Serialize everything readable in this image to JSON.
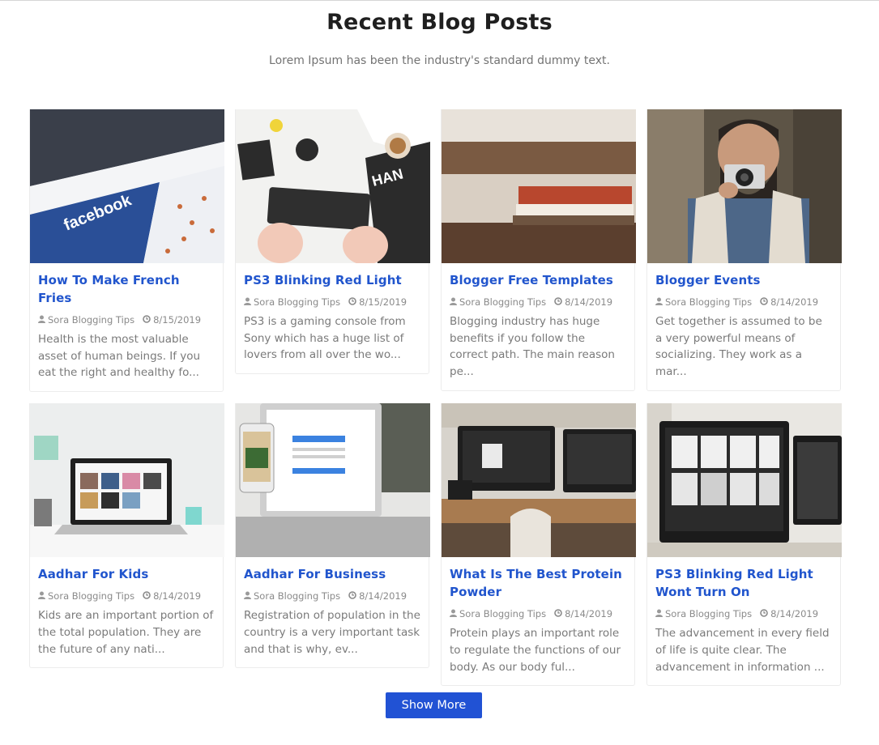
{
  "section": {
    "title": "Recent Blog Posts",
    "subtitle": "Lorem Ipsum has been the industry's standard dummy text."
  },
  "posts": [
    {
      "title": "How To Make French Fries",
      "author": "Sora Blogging Tips",
      "date": "8/15/2019",
      "excerpt": "Health is the most valuable asset of human beings. If you eat the right and healthy fo...",
      "image": "facebook-screen-photo"
    },
    {
      "title": "PS3 Blinking Red Light",
      "author": "Sora Blogging Tips",
      "date": "8/15/2019",
      "excerpt": "PS3 is a gaming console from Sony which has a huge list of lovers from all over the wo...",
      "image": "keyboard-desk-photo"
    },
    {
      "title": "Blogger Free Templates",
      "author": "Sora Blogging Tips",
      "date": "8/14/2019",
      "excerpt": "Blogging industry has huge benefits if you follow the correct path. The main reason pe...",
      "image": "books-on-stairs-photo"
    },
    {
      "title": "Blogger Events",
      "author": "Sora Blogging Tips",
      "date": "8/14/2019",
      "excerpt": "Get together is assumed to be a very powerful means of socializing. They work as a mar...",
      "image": "man-with-camera-photo"
    },
    {
      "title": "Aadhar For Kids",
      "author": "Sora Blogging Tips",
      "date": "8/14/2019",
      "excerpt": "Kids are an important portion of the total population. They are the future of any nati...",
      "image": "laptop-desk-photo"
    },
    {
      "title": "Aadhar For Business",
      "author": "Sora Blogging Tips",
      "date": "8/14/2019",
      "excerpt": "Registration of population in the country is a very important task and that is why, ev...",
      "image": "laptop-phone-instagram-photo"
    },
    {
      "title": "What Is The Best Protein Powder",
      "author": "Sora Blogging Tips",
      "date": "8/14/2019",
      "excerpt": "Protein plays an important role to regulate the functions of our body. As our body ful...",
      "image": "dual-monitor-desk-photo"
    },
    {
      "title": "PS3 Blinking Red Light Wont Turn On",
      "author": "Sora Blogging Tips",
      "date": "8/14/2019",
      "excerpt": "The advancement in every field of life is quite clear. The advancement in information ...",
      "image": "imac-screen-photo"
    }
  ],
  "actions": {
    "show_more_label": "Show More"
  },
  "colors": {
    "accent": "#2155cd",
    "button": "#2152d4",
    "text_muted": "#7a7a7a"
  },
  "icons": {
    "author": "user-icon",
    "date": "clock-icon"
  }
}
